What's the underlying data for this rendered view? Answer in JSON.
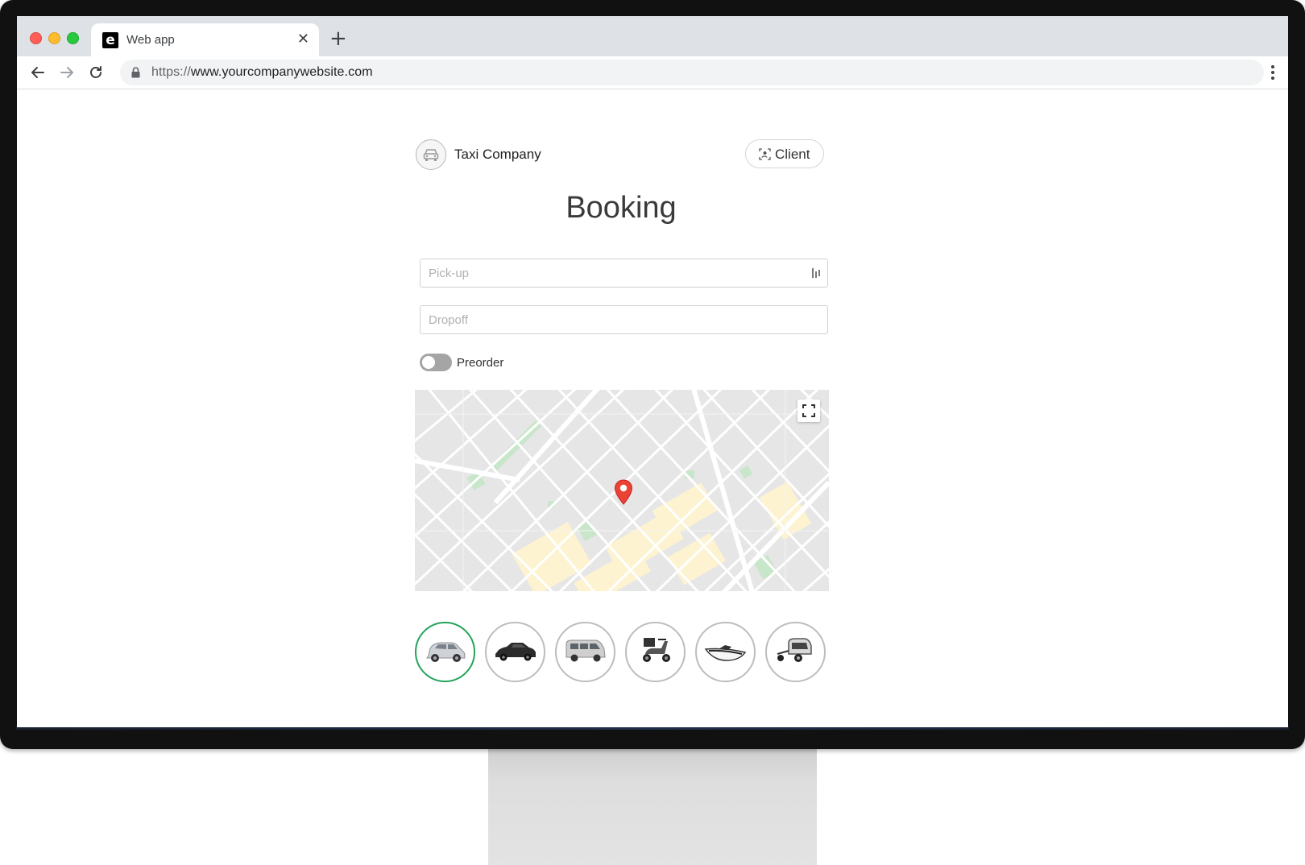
{
  "browser": {
    "tab": {
      "favicon": "e",
      "title": "Web app",
      "close": "✕"
    },
    "new_tab": "+",
    "url": {
      "scheme": "https://",
      "host": "www.yourcompanywebsite.com"
    }
  },
  "header": {
    "brand_name": "Taxi Company",
    "client_button": "Client"
  },
  "main": {
    "title": "Booking",
    "pickup": {
      "placeholder": "Pick-up",
      "value": ""
    },
    "dropoff": {
      "placeholder": "Dropoff",
      "value": ""
    },
    "preorder": {
      "label": "Preorder",
      "enabled": false
    }
  },
  "map": {
    "pin_color": "#ea4335",
    "park_color": "#c8e6c9",
    "block_color": "#fdf3d0"
  },
  "vehicles": [
    {
      "icon": "compact-car-icon",
      "selected": true
    },
    {
      "icon": "sedan-car-icon",
      "selected": false
    },
    {
      "icon": "minivan-icon",
      "selected": false
    },
    {
      "icon": "scooter-icon",
      "selected": false
    },
    {
      "icon": "boat-icon",
      "selected": false
    },
    {
      "icon": "rickshaw-icon",
      "selected": false
    }
  ],
  "colors": {
    "accent_selected": "#23a35b",
    "toggle_off": "#a5a5a5"
  }
}
